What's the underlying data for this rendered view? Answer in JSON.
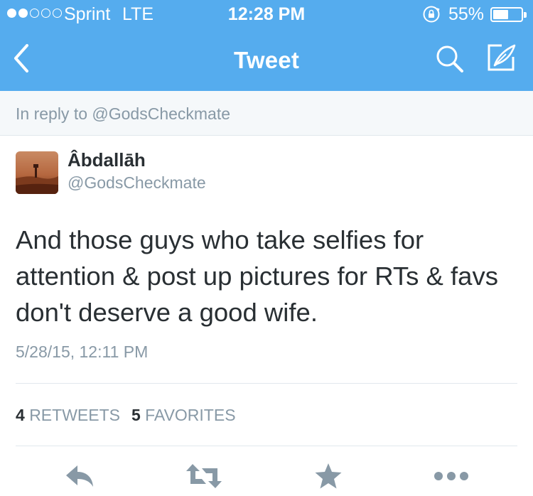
{
  "status_bar": {
    "carrier": "Sprint",
    "network": "LTE",
    "time": "12:28 PM",
    "battery_text": "55%",
    "battery_level": 0.55,
    "signal_bars_filled": 2,
    "signal_bars_total": 5
  },
  "nav": {
    "title": "Tweet",
    "back_icon": "chevron-left-icon",
    "search_icon": "search-icon",
    "compose_icon": "compose-icon"
  },
  "reply_context": "In reply to @GodsCheckmate",
  "tweet": {
    "author_name": "Âbdallāh",
    "author_handle": "@GodsCheckmate",
    "text": "And those guys who take selfies for attention & post up pictures for RTs & favs don't deserve a good wife.",
    "timestamp": "5/28/15, 12:11 PM"
  },
  "stats": {
    "retweets_count": "4",
    "retweets_label": "RETWEETS",
    "favorites_count": "5",
    "favorites_label": "FAVORITES"
  },
  "actions": [
    "reply-icon",
    "retweet-icon",
    "favorite-star-icon",
    "more-icon"
  ],
  "colors": {
    "brand_blue": "#55acee",
    "text_dark": "#292f33",
    "text_gray": "#8899a6",
    "icon_gray": "#8899a6",
    "divider": "#e1e8ed",
    "reply_bg": "#f5f8fa"
  }
}
